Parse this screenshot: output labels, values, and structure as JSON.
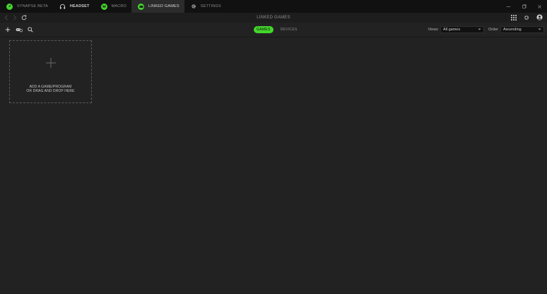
{
  "tabs": [
    {
      "label": "SYNAPSE BETA",
      "icon": "razer-logo-icon"
    },
    {
      "label": "HEADSET",
      "icon": "headset-icon"
    },
    {
      "label": "MACRO",
      "icon": "macro-icon"
    },
    {
      "label": "LINKED GAMES",
      "icon": "gamepad-icon"
    },
    {
      "label": "SETTINGS",
      "icon": "gear-icon"
    }
  ],
  "header": {
    "title": "LINKED GAMES"
  },
  "segments": [
    {
      "label": "GAMES",
      "active": true
    },
    {
      "label": "DEVICES",
      "active": false
    }
  ],
  "filters": {
    "views_label": "Views",
    "views_value": "All games",
    "order_label": "Order",
    "order_value": "Ascending"
  },
  "add_card": {
    "line1": "ADD A GAME/PROGRAM",
    "line2": "OR DRAG AND DROP HERE"
  },
  "colors": {
    "accent": "#44d62c",
    "background": "#222222",
    "topbar": "#111111"
  }
}
